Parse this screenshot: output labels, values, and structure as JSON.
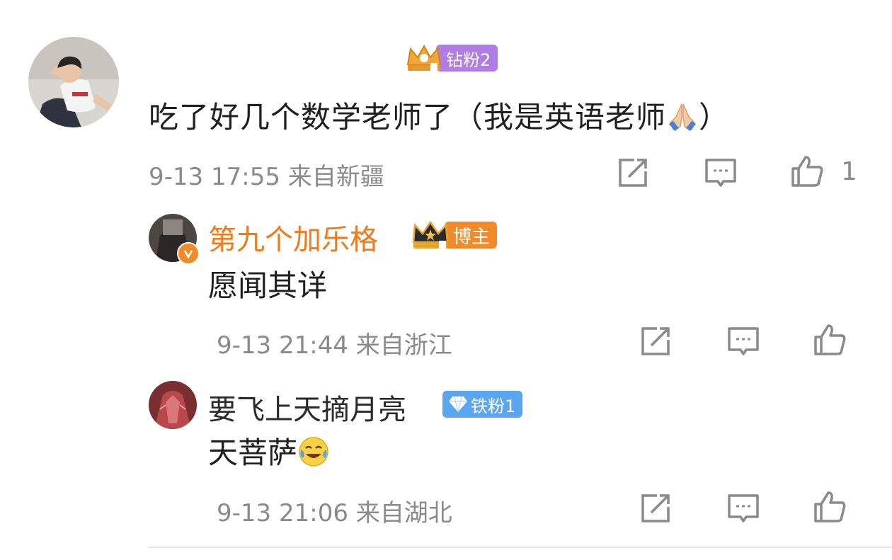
{
  "comment": {
    "badge_label": "钻粉2",
    "text": "吃了好几个数学老师了（我是英语老师",
    "text_close": "）",
    "time": "9-13 17:55",
    "location": "来自新疆",
    "like_count": "1"
  },
  "replies": [
    {
      "username": "第九个加乐格",
      "badge_label": "博主",
      "text": "愿闻其详",
      "time": "9-13 21:44",
      "location": "来自浙江"
    },
    {
      "username": "要飞上天摘月亮",
      "badge_label": "铁粉1",
      "text": "天菩萨",
      "time": "9-13 21:06",
      "location": "来自湖北"
    }
  ],
  "icons": {
    "share": "share-icon",
    "comment": "comment-icon",
    "like": "thumbs-up-icon",
    "pray": "praying-hands-emoji",
    "laugh": "crying-laughing-emoji",
    "verified": "verified-v-icon"
  },
  "colors": {
    "username_orange": "#f17a1a",
    "badge_purple": "#b07ce6",
    "badge_orange": "#f28a2a",
    "badge_blue": "#5aa6f0",
    "meta_gray": "#8a8a8a"
  }
}
